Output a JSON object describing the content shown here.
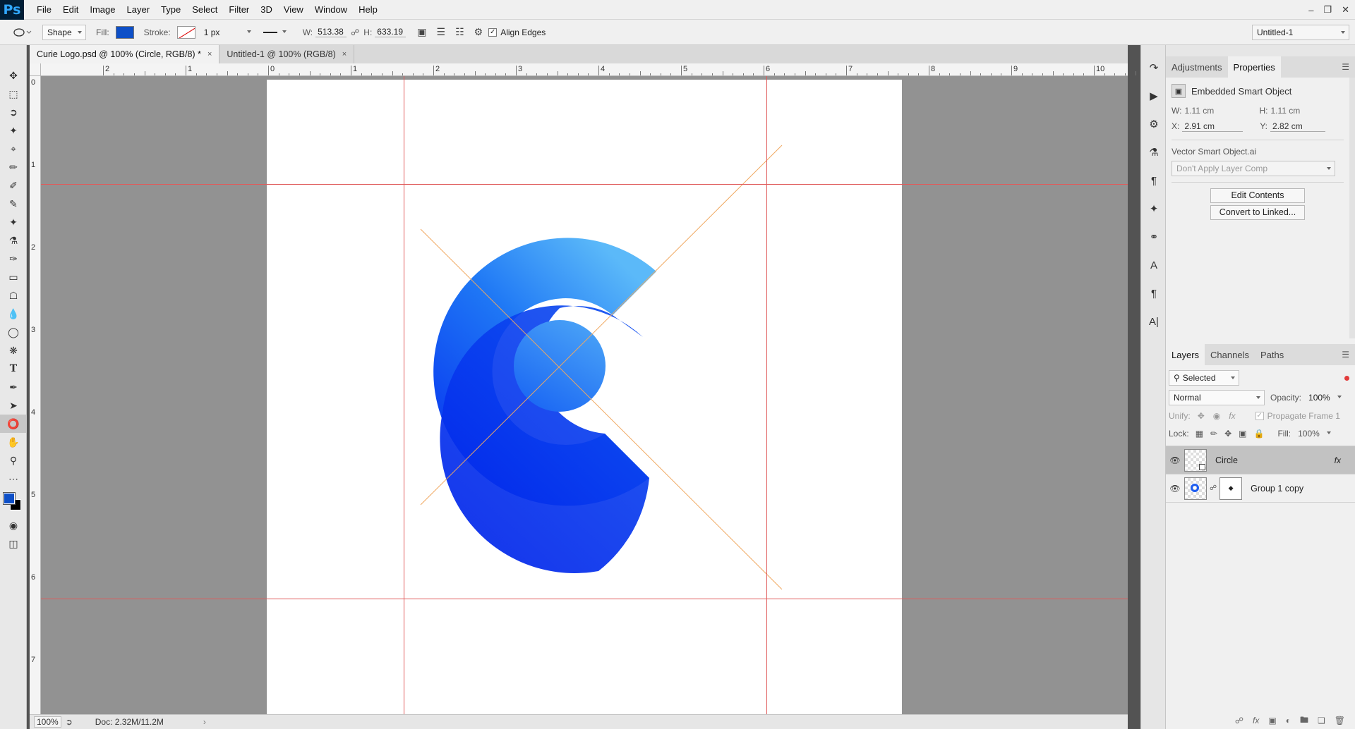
{
  "app": {
    "logo": "Ps"
  },
  "menu": [
    "File",
    "Edit",
    "Image",
    "Layer",
    "Type",
    "Select",
    "Filter",
    "3D",
    "View",
    "Window",
    "Help"
  ],
  "options": {
    "shape_mode": "Shape",
    "fill_label": "Fill:",
    "fill_color": "#0d4fc7",
    "stroke_label": "Stroke:",
    "stroke_width": "1 px",
    "w_label": "W:",
    "w_value": "513.38",
    "h_label": "H:",
    "h_value": "633.19",
    "align_edges": "Align Edges",
    "workspace": "Untitled-1"
  },
  "tabs": [
    {
      "label": "Curie Logo.psd @ 100% (Circle, RGB/8) *",
      "close": "×"
    },
    {
      "label": "Untitled-1 @ 100% (RGB/8)",
      "close": "×"
    }
  ],
  "ruler_top": [
    "2",
    "1",
    "0",
    "1",
    "2",
    "3",
    "4",
    "5",
    "6",
    "7",
    "8",
    "9",
    "10"
  ],
  "ruler_left": [
    "0",
    "1",
    "2",
    "3",
    "4",
    "5",
    "6",
    "7"
  ],
  "status": {
    "zoom": "100%",
    "doc": "Doc: 2.32M/11.2M"
  },
  "properties_panel": {
    "tabs": [
      "Adjustments",
      "Properties"
    ],
    "title": "Embedded Smart Object",
    "w": "1.11 cm",
    "h": "1.11 cm",
    "x": "2.91 cm",
    "y": "2.82 cm",
    "w_label": "W:",
    "h_label": "H:",
    "x_label": "X:",
    "y_label": "Y:",
    "file": "Vector Smart Object.ai",
    "layer_comp": "Don't Apply Layer Comp",
    "edit_contents": "Edit Contents",
    "convert": "Convert to Linked..."
  },
  "layers_panel": {
    "tabs": [
      "Layers",
      "Channels",
      "Paths"
    ],
    "filter": "Selected",
    "blend_mode": "Normal",
    "opacity_label": "Opacity:",
    "opacity": "100%",
    "unify_label": "Unify:",
    "propagate": "Propagate Frame 1",
    "lock_label": "Lock:",
    "fill_label": "Fill:",
    "fill": "100%",
    "layers": [
      {
        "name": "Circle",
        "fx": "fx"
      },
      {
        "name": "Group 1 copy"
      }
    ]
  },
  "colors": {
    "accent_dark": "#0022e8",
    "accent_light": "#55b3f8",
    "guide": "#e05a5a"
  }
}
